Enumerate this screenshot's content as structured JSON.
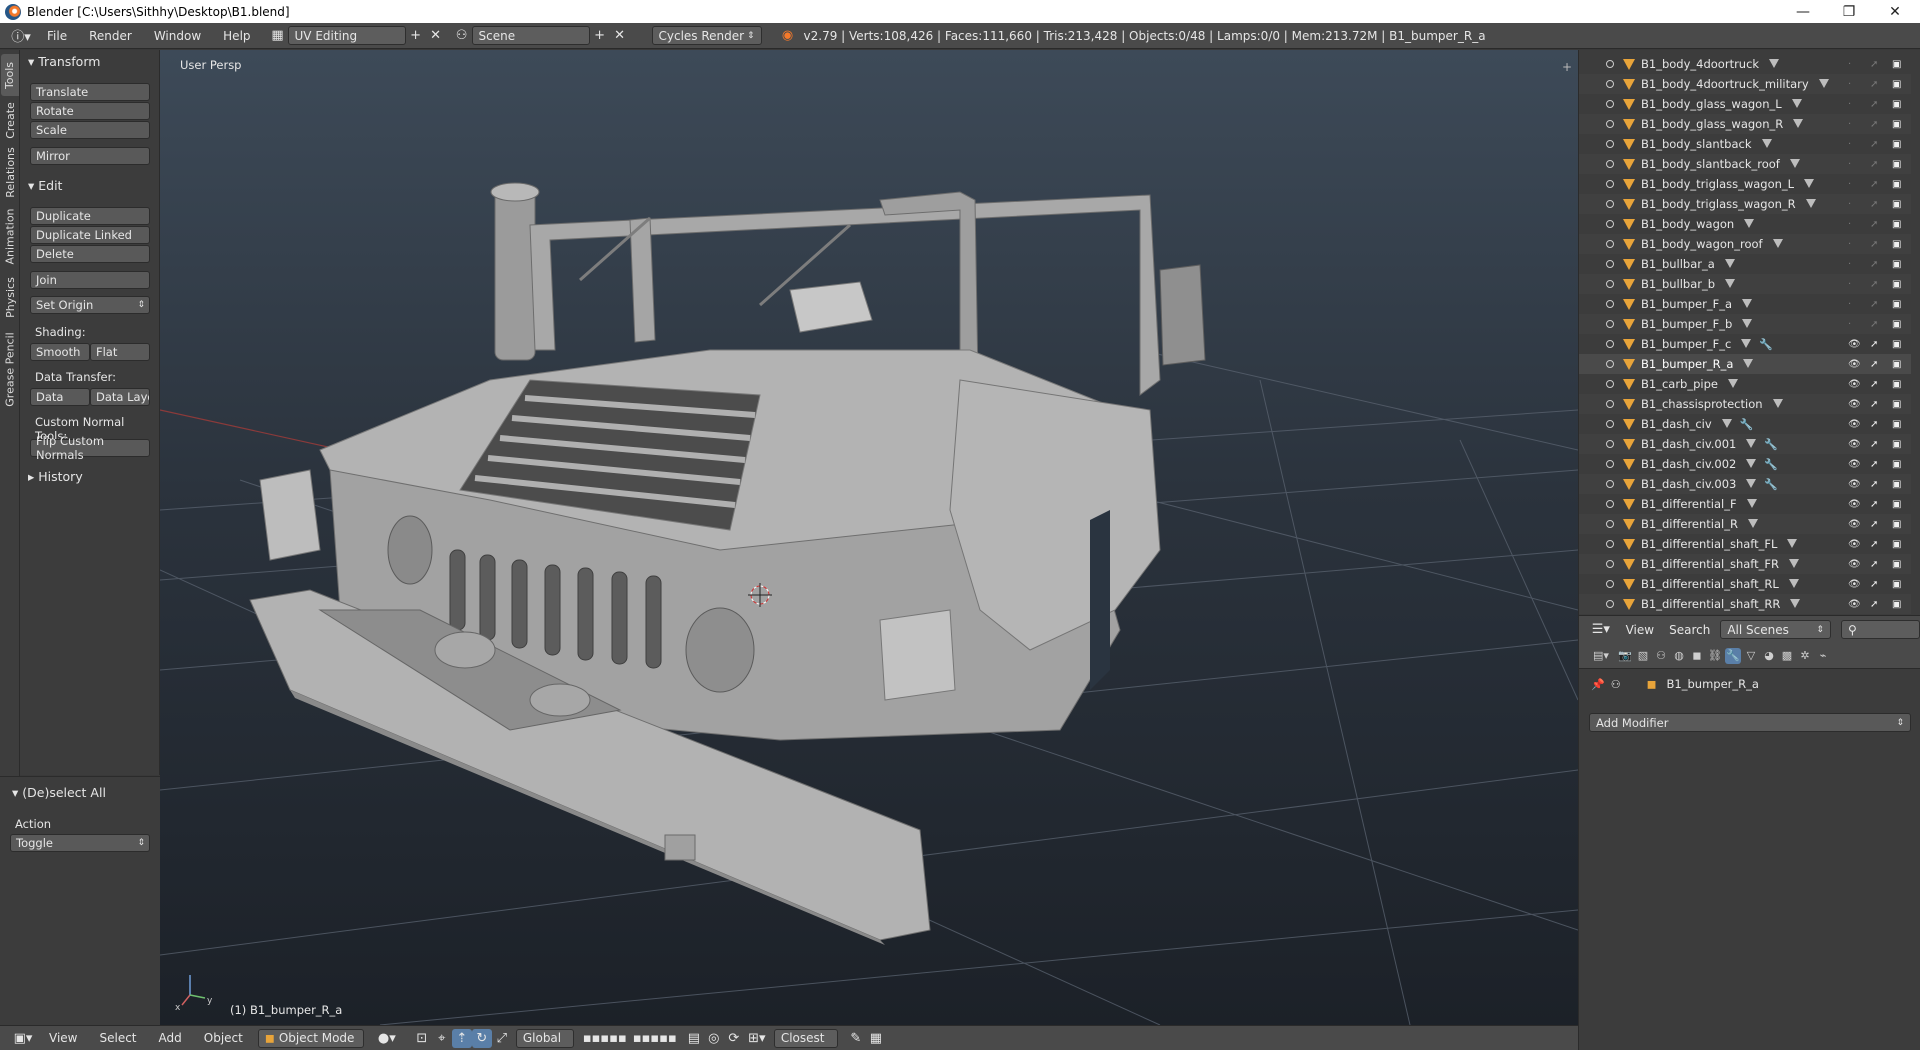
{
  "window": {
    "title": "Blender [C:\\Users\\Sithhy\\Desktop\\B1.blend]",
    "minimize": "—",
    "maximize": "❐",
    "close": "✕"
  },
  "info_header": {
    "menus": [
      "File",
      "Render",
      "Window",
      "Help"
    ],
    "screen_layout": "UV Editing",
    "scene": "Scene",
    "render_engine": "Cycles Render",
    "stats": "v2.79 | Verts:108,426 | Faces:111,660 | Tris:213,428 | Objects:0/48 | Lamps:0/0 | Mem:213.72M | B1_bumper_R_a"
  },
  "tabs": [
    "Tools",
    "Create",
    "Relations",
    "Animation",
    "Physics",
    "Grease Pencil"
  ],
  "toolshelf": {
    "transform_header": "Transform",
    "translate": "Translate",
    "rotate": "Rotate",
    "scale": "Scale",
    "mirror": "Mirror",
    "edit_header": "Edit",
    "duplicate": "Duplicate",
    "duplicate_linked": "Duplicate Linked",
    "delete": "Delete",
    "join": "Join",
    "set_origin": "Set Origin",
    "shading_label": "Shading:",
    "smooth": "Smooth",
    "flat": "Flat",
    "data_transfer_label": "Data Transfer:",
    "data": "Data",
    "data_layout": "Data Layo",
    "custom_normal_label": "Custom Normal Tools:",
    "flip_normals": "Flip Custom Normals",
    "history_header": "History"
  },
  "operator_panel": {
    "header": "(De)select All",
    "action_label": "Action",
    "action_value": "Toggle"
  },
  "viewport": {
    "view_label": "User Persp",
    "object_label": "(1) B1_bumper_R_a"
  },
  "bottom_header": {
    "menus": [
      "View",
      "Select",
      "Add",
      "Object"
    ],
    "mode": "Object Mode",
    "orientation": "Global",
    "snap": "Closest"
  },
  "outliner": {
    "rows": [
      {
        "name": "B1_body_4doortruck",
        "wrench": false,
        "visible": false
      },
      {
        "name": "B1_body_4doortruck_military",
        "wrench": false,
        "visible": false
      },
      {
        "name": "B1_body_glass_wagon_L",
        "wrench": false,
        "visible": false
      },
      {
        "name": "B1_body_glass_wagon_R",
        "wrench": false,
        "visible": false
      },
      {
        "name": "B1_body_slantback",
        "wrench": false,
        "visible": false
      },
      {
        "name": "B1_body_slantback_roof",
        "wrench": false,
        "visible": false
      },
      {
        "name": "B1_body_triglass_wagon_L",
        "wrench": false,
        "visible": false
      },
      {
        "name": "B1_body_triglass_wagon_R",
        "wrench": false,
        "visible": false
      },
      {
        "name": "B1_body_wagon",
        "wrench": false,
        "visible": false
      },
      {
        "name": "B1_body_wagon_roof",
        "wrench": false,
        "visible": false
      },
      {
        "name": "B1_bullbar_a",
        "wrench": false,
        "visible": false
      },
      {
        "name": "B1_bullbar_b",
        "wrench": false,
        "visible": false
      },
      {
        "name": "B1_bumper_F_a",
        "wrench": false,
        "visible": false
      },
      {
        "name": "B1_bumper_F_b",
        "wrench": false,
        "visible": false
      },
      {
        "name": "B1_bumper_F_c",
        "wrench": true,
        "visible": true
      },
      {
        "name": "B1_bumper_R_a",
        "wrench": false,
        "visible": true
      },
      {
        "name": "B1_carb_pipe",
        "wrench": false,
        "visible": true
      },
      {
        "name": "B1_chassisprotection",
        "wrench": false,
        "visible": true
      },
      {
        "name": "B1_dash_civ",
        "wrench": true,
        "visible": true
      },
      {
        "name": "B1_dash_civ.001",
        "wrench": true,
        "visible": true
      },
      {
        "name": "B1_dash_civ.002",
        "wrench": true,
        "visible": true
      },
      {
        "name": "B1_dash_civ.003",
        "wrench": true,
        "visible": true
      },
      {
        "name": "B1_differential_F",
        "wrench": false,
        "visible": true
      },
      {
        "name": "B1_differential_R",
        "wrench": false,
        "visible": true
      },
      {
        "name": "B1_differential_shaft_FL",
        "wrench": false,
        "visible": true
      },
      {
        "name": "B1_differential_shaft_FR",
        "wrench": false,
        "visible": true
      },
      {
        "name": "B1_differential_shaft_RL",
        "wrench": false,
        "visible": true
      },
      {
        "name": "B1_differential_shaft_RR",
        "wrench": false,
        "visible": true
      }
    ],
    "footer": {
      "view": "View",
      "search": "Search",
      "scope": "All Scenes"
    }
  },
  "properties": {
    "object_name": "B1_bumper_R_a",
    "add_modifier": "Add Modifier"
  }
}
